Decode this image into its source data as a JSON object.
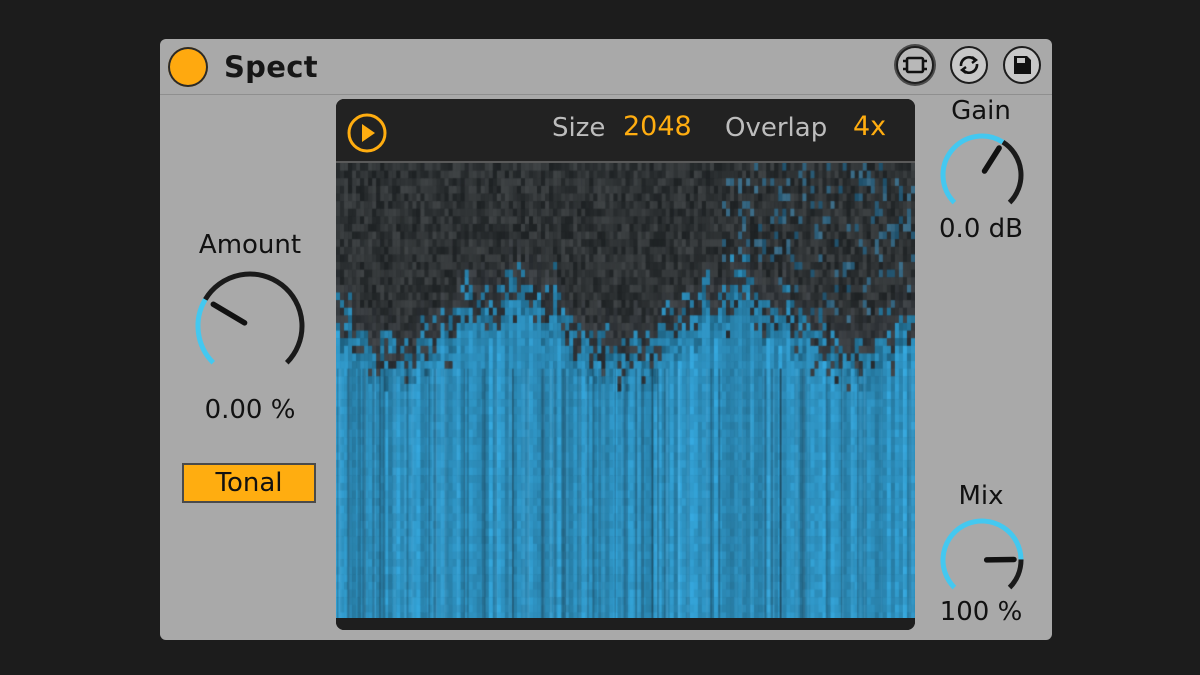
{
  "device": {
    "title": "Spect",
    "power_on": true
  },
  "titlebar_buttons": [
    "device-view-icon",
    "swap-icon",
    "save-icon"
  ],
  "amount": {
    "label": "Amount",
    "value": "0.00 %",
    "level": 0.28
  },
  "mode_button": {
    "label": "Tonal",
    "active": true
  },
  "spectrum": {
    "size_label": "Size",
    "size_value": "2048",
    "overlap_label": "Overlap",
    "overlap_value": "4x"
  },
  "gain": {
    "label": "Gain",
    "value": "0.0 dB",
    "level": 0.62
  },
  "mix": {
    "label": "Mix",
    "value": "100 %",
    "level": 0.83
  },
  "colors": {
    "accent": "#ffad10",
    "knob_active": "#44c8f0",
    "knob_inactive": "#1a1a1a",
    "spectrum_blue": "#3ea4cf",
    "device_bg": "#a9a9a9"
  }
}
